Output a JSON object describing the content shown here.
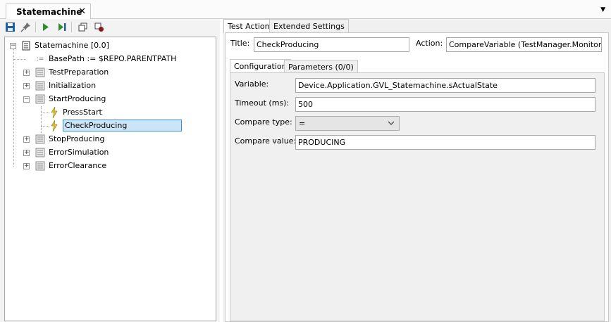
{
  "document_tab": {
    "title": "Statemachine",
    "close_glyph": "✕"
  },
  "toolbar": {
    "buttons": [
      {
        "name": "save-icon",
        "color": "#1f5fa8"
      },
      {
        "name": "pin-icon",
        "color": "#555555"
      },
      {
        "name": "run-icon",
        "color": "#2e8b2e"
      },
      {
        "name": "step-icon",
        "color": "#2e8b2e"
      },
      {
        "name": "copy-icon",
        "color": "#444444"
      },
      {
        "name": "breakpoint-icon",
        "color": "#8b1a1a"
      }
    ]
  },
  "tree": {
    "root": "Statemachine [0.0]",
    "basepath": "BasePath := $REPO.PARENTPATH",
    "basepath_glyph": ":=",
    "items": [
      {
        "label": "TestPreparation"
      },
      {
        "label": "Initialization"
      },
      {
        "label": "StartProducing"
      },
      {
        "label": "PressStart"
      },
      {
        "label": "CheckProducing"
      },
      {
        "label": "StopProducing"
      },
      {
        "label": "ErrorSimulation"
      },
      {
        "label": "ErrorClearance"
      }
    ],
    "selected_color": "#cce4f7",
    "selected_border": "#3a90d8"
  },
  "right": {
    "tabs": [
      "Test Action",
      "Extended Settings"
    ],
    "title_label": "Title:",
    "title_value": "CheckProducing",
    "action_label": "Action:",
    "action_value": "CompareVariable (TestManager.Monitoring)",
    "subtabs": [
      "Configuration",
      "Parameters (0/0)"
    ],
    "fields": {
      "variable_label": "Variable:",
      "variable_value": "Device.Application.GVL_Statemachine.sActualState",
      "timeout_label": "Timeout (ms):",
      "timeout_value": "500",
      "compare_type_label": "Compare type:",
      "compare_type_value": "=",
      "compare_value_label": "Compare value:",
      "compare_value_value": "PRODUCING"
    }
  }
}
